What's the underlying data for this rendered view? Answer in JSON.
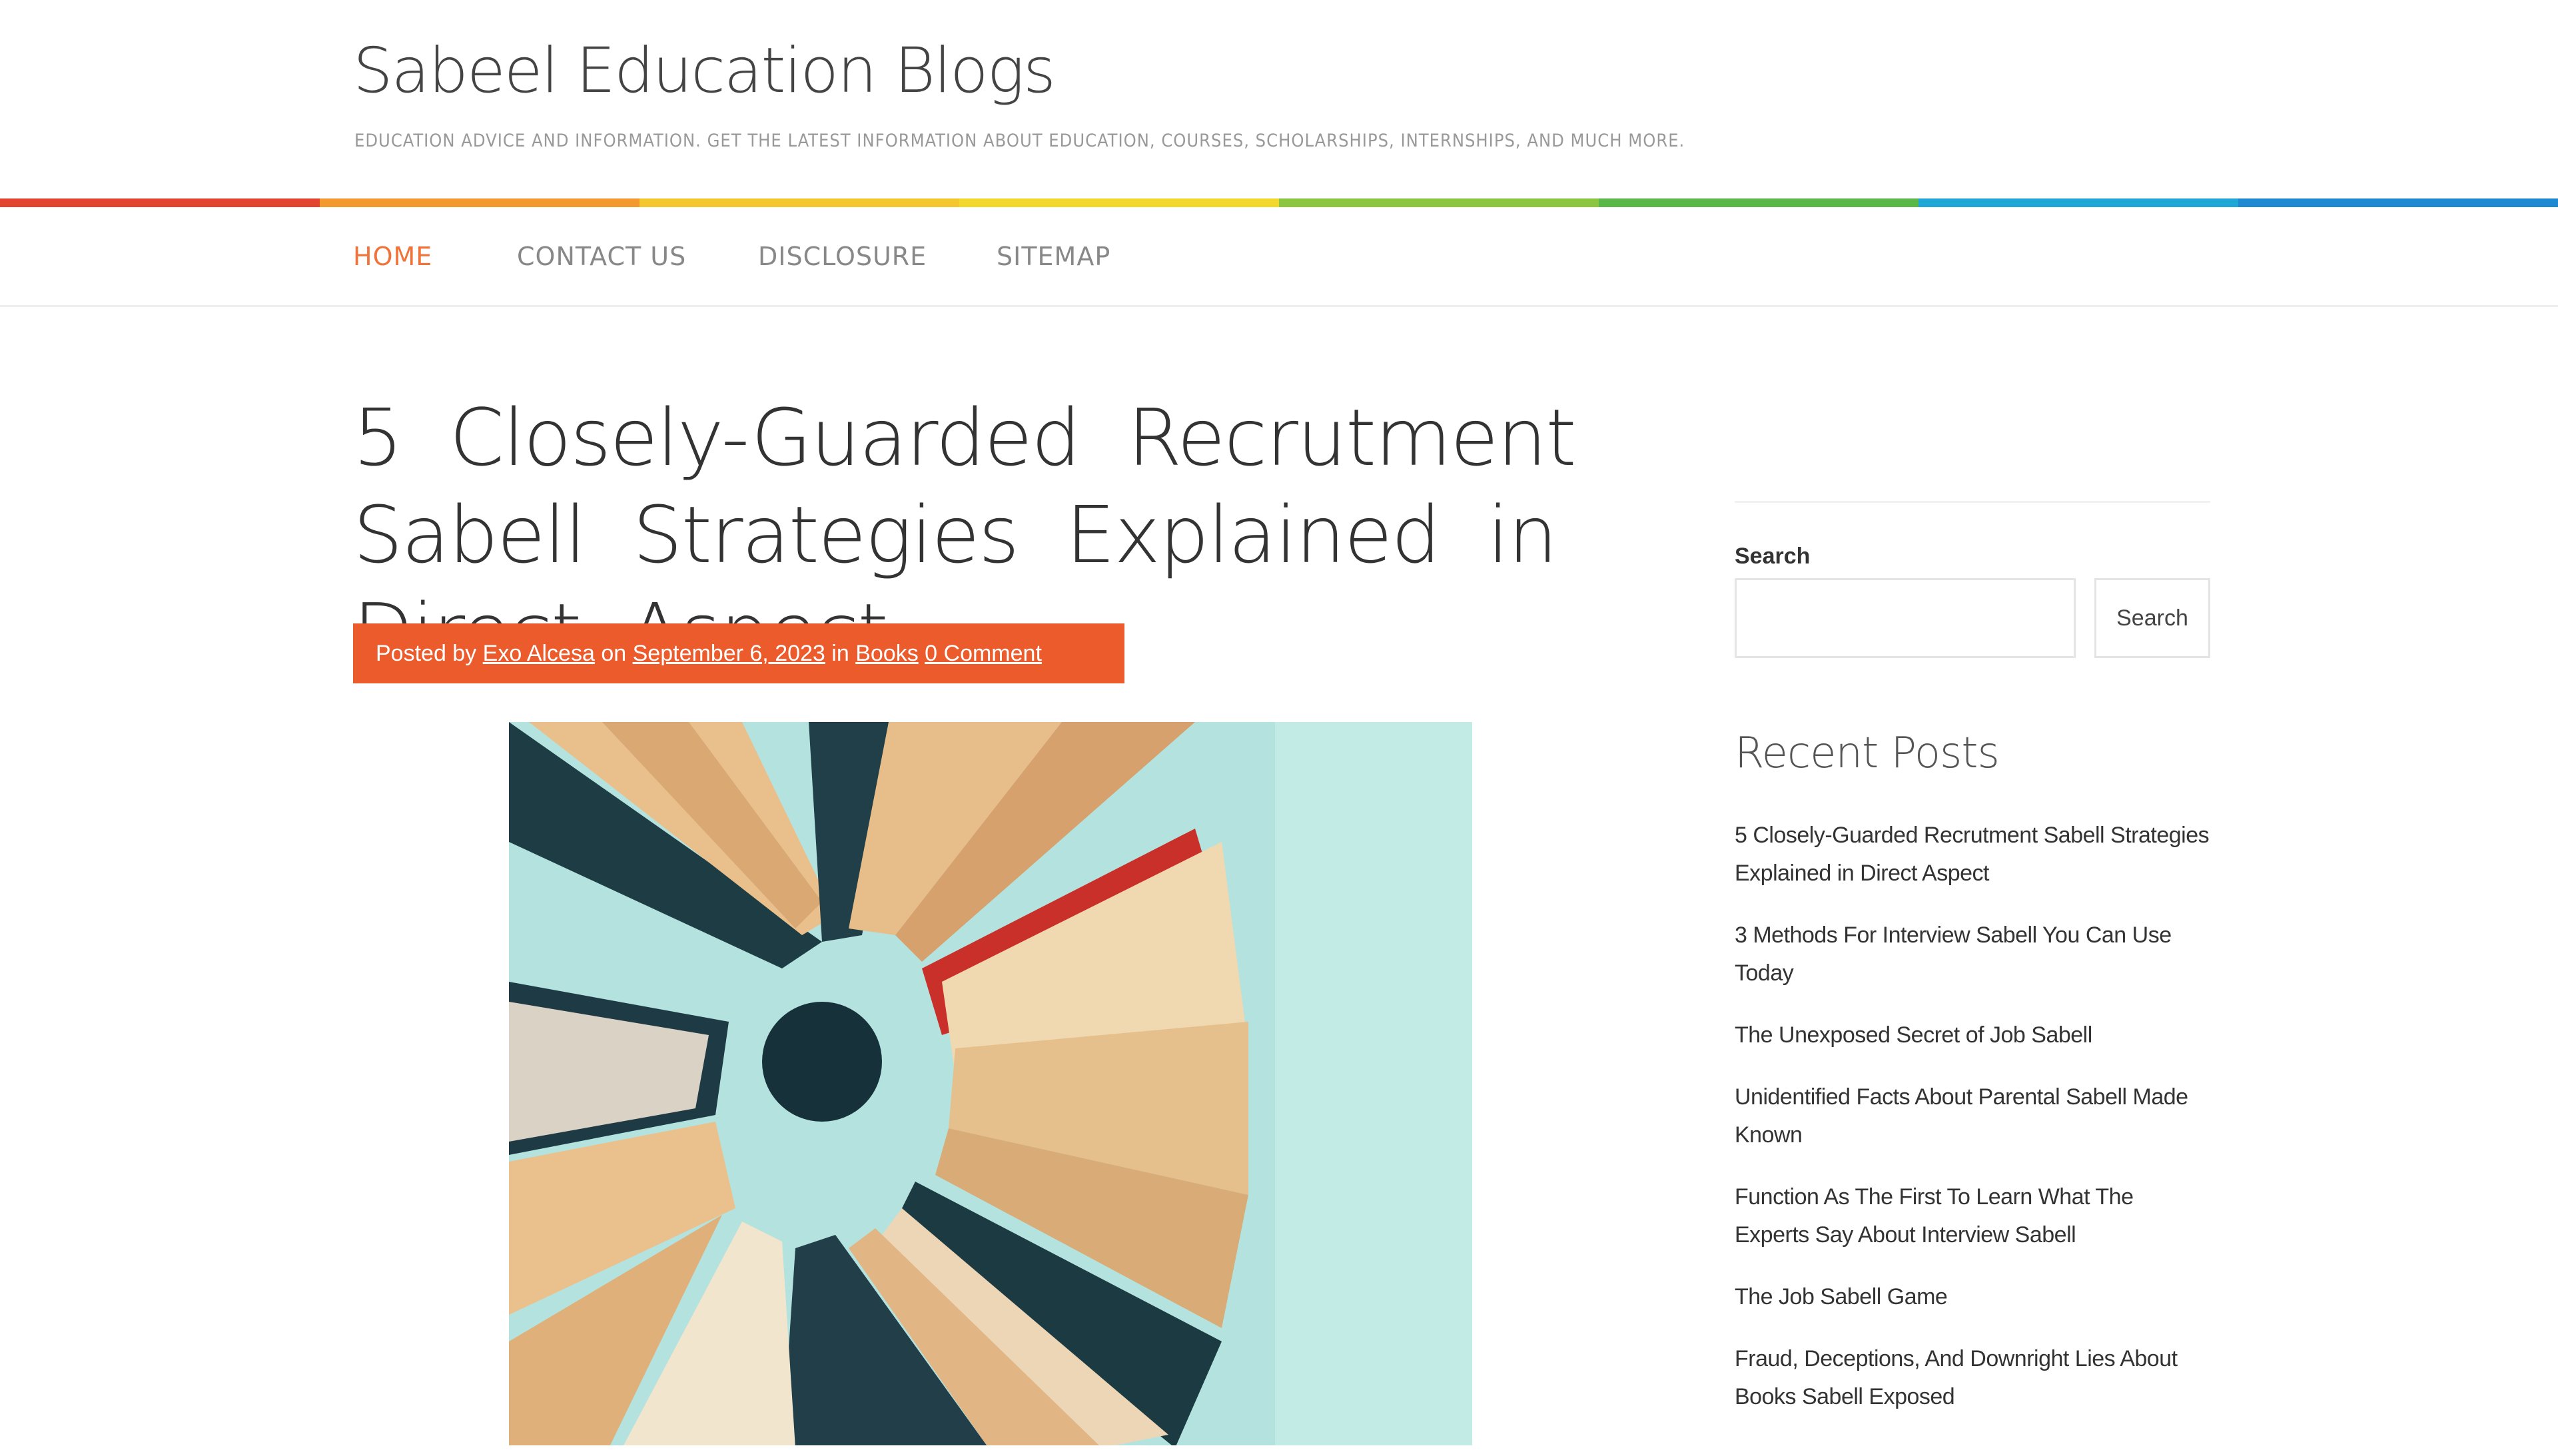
{
  "site": {
    "title": "Sabeel Education Blogs",
    "description": "EDUCATION ADVICE AND INFORMATION. GET THE LATEST INFORMATION ABOUT EDUCATION, COURSES, SCHOLARSHIPS, INTERNSHIPS, AND MUCH MORE."
  },
  "colors": {
    "accent": "#ec5b2c",
    "rainbow": [
      "#e2452f",
      "#f29a2e",
      "#f4c630",
      "#f2d82c",
      "#8cc640",
      "#59b847",
      "#1fa6d7",
      "#1e88d1"
    ]
  },
  "nav": {
    "items": [
      {
        "label": "HOME",
        "active": true
      },
      {
        "label": "CONTACT US"
      },
      {
        "label": "DISCLOSURE"
      },
      {
        "label": "SITEMAP"
      }
    ]
  },
  "post": {
    "title": "5 Closely-Guarded Recrutment Sabell Strategies Explained in Direct Aspect",
    "meta": {
      "posted_by": "Posted by",
      "author": "Exo Alcesa",
      "on": "on",
      "date": "September 6, 2023",
      "in": "in",
      "category": "Books",
      "comments": "0 Comment"
    },
    "image_alt": "Open books arranged in a circle"
  },
  "sidebar": {
    "search": {
      "label": "Search",
      "placeholder": "",
      "button": "Search"
    },
    "recent_posts": {
      "heading": "Recent Posts",
      "items": [
        "5 Closely-Guarded Recrutment Sabell Strategies Explained in Direct Aspect",
        "3 Methods For Interview Sabell You Can Use Today",
        "The Unexposed Secret of Job Sabell",
        "Unidentified Facts About Parental Sabell Made Known",
        "Function As The First To Learn What The Experts Say About Interview Sabell",
        "The Job Sabell Game",
        "Fraud, Deceptions, And Downright Lies About Books Sabell Exposed"
      ]
    }
  }
}
